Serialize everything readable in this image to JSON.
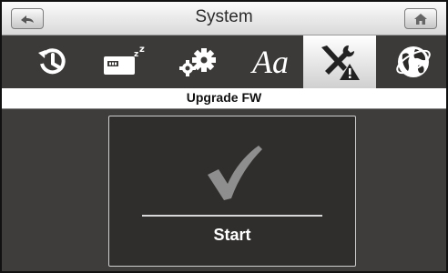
{
  "header": {
    "title": "System",
    "back_icon": "back-arrow-icon",
    "home_icon": "home-icon"
  },
  "tabs": [
    {
      "name": "clock",
      "icon": "clock-history-icon"
    },
    {
      "name": "battery-sleep",
      "icon": "battery-sleep-icon"
    },
    {
      "name": "settings",
      "icon": "gears-icon"
    },
    {
      "name": "font",
      "icon": "font-icon",
      "label": "Aa"
    },
    {
      "name": "tools",
      "icon": "tools-warning-icon",
      "active": true
    },
    {
      "name": "globe",
      "icon": "globe-icon"
    }
  ],
  "subheader": {
    "title": "Upgrade FW"
  },
  "panel": {
    "button_label": "Start",
    "icon": "checkmark-icon"
  },
  "colors": {
    "background": "#3e3d3b",
    "panel": "#302e2c",
    "active_tab": "#e9e9e9"
  }
}
